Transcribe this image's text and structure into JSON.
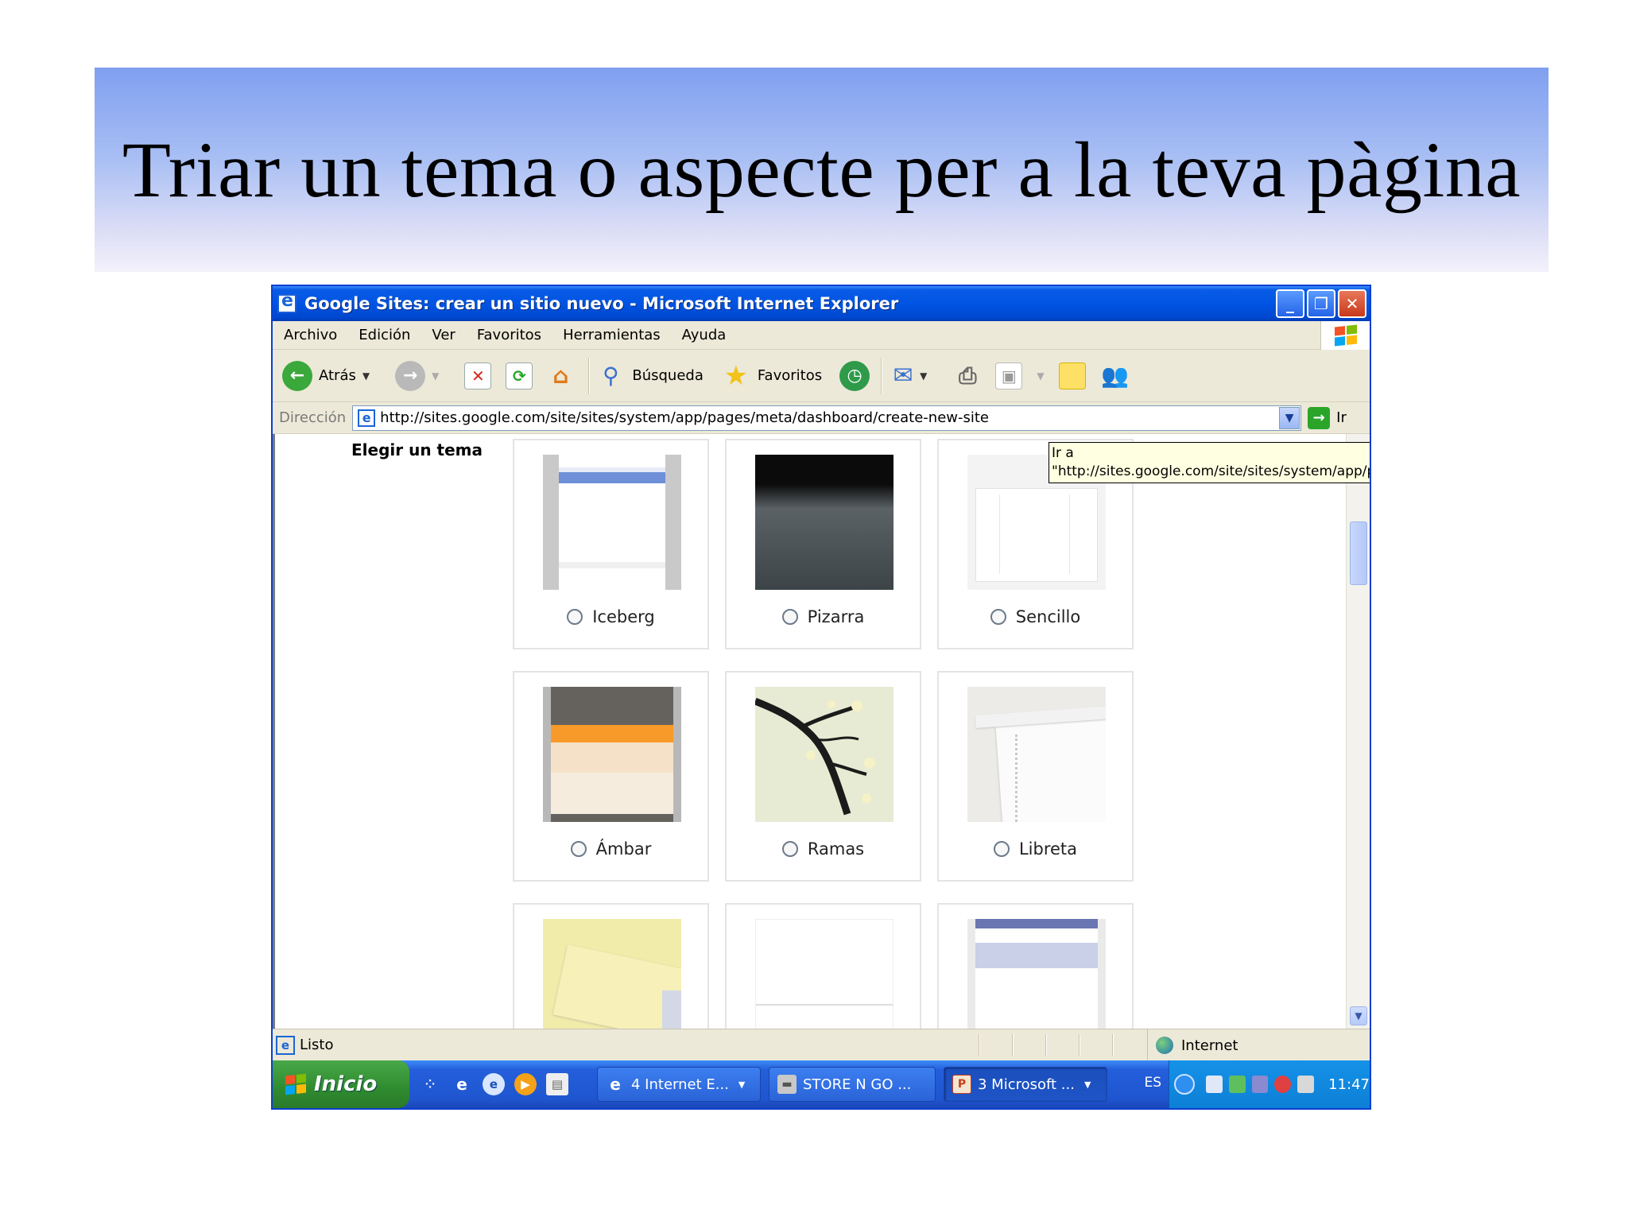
{
  "slide": {
    "title": "Triar un tema o aspecte per a la teva pàgina"
  },
  "window": {
    "title": "Google Sites: crear un sitio nuevo - Microsoft Internet Explorer",
    "minimize_icon": "minimize-icon",
    "maximize_icon": "restore-icon",
    "close_icon": "close-icon"
  },
  "menu": {
    "items": [
      "Archivo",
      "Edición",
      "Ver",
      "Favoritos",
      "Herramientas",
      "Ayuda"
    ]
  },
  "toolbar": {
    "back_label": "Atrás",
    "search_label": "Búsqueda",
    "favorites_label": "Favoritos"
  },
  "address": {
    "label": "Dirección",
    "url": "http://sites.google.com/site/sites/system/app/pages/meta/dashboard/create-new-site",
    "go_label": "Ir"
  },
  "tooltip": {
    "line1": "Ir a",
    "line2": "\"http://sites.google.com/site/sites/system/app/pages/meta/dashboard/create-new-site\""
  },
  "page": {
    "heading": "Elegir un tema",
    "themes": [
      {
        "name": "Iceberg"
      },
      {
        "name": "Pizarra"
      },
      {
        "name": "Sencillo"
      },
      {
        "name": "Ámbar"
      },
      {
        "name": "Ramas"
      },
      {
        "name": "Libreta"
      }
    ]
  },
  "status": {
    "text": "Listo",
    "zone": "Internet"
  },
  "taskbar": {
    "start_label": "Inicio",
    "tasks": [
      "4 Internet E...",
      "STORE N GO ...",
      "3 Microsoft ..."
    ],
    "language": "ES",
    "clock": "11:47"
  },
  "colors": {
    "titlebar": "#0054e3",
    "taskbar": "#245edb",
    "start_button": "#2f8b2f",
    "tooltip_bg": "#ffffe1"
  }
}
